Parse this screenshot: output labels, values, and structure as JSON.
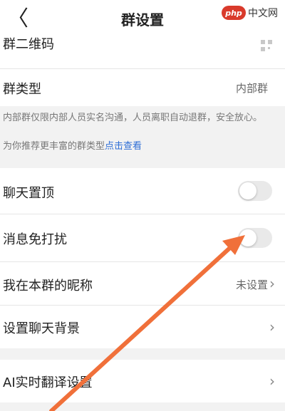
{
  "header": {
    "back_glyph": "〈",
    "title": "群设置"
  },
  "watermark": {
    "logo": "php",
    "text": "中文网"
  },
  "rows": {
    "qrcode_label": "群二维码",
    "group_type_label": "群类型",
    "group_type_value": "内部群",
    "pin_chat_label": "聊天置顶",
    "mute_label": "消息免打扰",
    "nickname_label": "我在本群的昵称",
    "nickname_value": "未设置",
    "background_label": "设置聊天背景",
    "translate_label": "AI实时翻译设置"
  },
  "note": {
    "line1": "内部群仅限内部人员实名沟通，人员离职自动退群，安全放心。",
    "line2_prefix": "为你推荐更丰富的群类型",
    "line2_link": "点击查看"
  },
  "toggles": {
    "pin_chat": false,
    "mute": false
  },
  "colors": {
    "arrow": "#f0703a",
    "link": "#2f6fd6"
  },
  "icons": {
    "back": "chevron-left-icon",
    "qrcode": "qr-code-icon",
    "chevron": "chevron-right-icon"
  }
}
